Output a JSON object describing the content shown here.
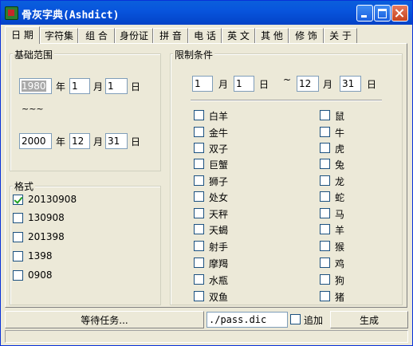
{
  "window": {
    "title": "骨灰字典(Ashdict)"
  },
  "tabs": [
    "日 期",
    "字符集",
    "组 合",
    "身份证",
    "拼 音",
    "电 话",
    "英 文",
    "其 他",
    "修 饰",
    "关 于"
  ],
  "date_range": {
    "title": "基础范围",
    "start": {
      "year": "1980",
      "month": "1",
      "day": "1"
    },
    "separator": "~~~",
    "end": {
      "year": "2000",
      "month": "12",
      "day": "31"
    },
    "units": {
      "year": "年",
      "month": "月",
      "day": "日"
    }
  },
  "format": {
    "title": "格式",
    "options": [
      {
        "label": "20130908",
        "checked": true
      },
      {
        "label": "130908",
        "checked": false
      },
      {
        "label": "201398",
        "checked": false
      },
      {
        "label": "1398",
        "checked": false
      },
      {
        "label": "0908",
        "checked": false
      }
    ]
  },
  "limits": {
    "title": "限制条件",
    "from": {
      "month": "1",
      "day": "1"
    },
    "tilde": "~",
    "to": {
      "month": "12",
      "day": "31"
    },
    "zodiac_signs": [
      "白羊",
      "金牛",
      "双子",
      "巨蟹",
      "狮子",
      "处女",
      "天秤",
      "天蝎",
      "射手",
      "摩羯",
      "水瓶",
      "双鱼"
    ],
    "chinese_zodiac": [
      "鼠",
      "牛",
      "虎",
      "兔",
      "龙",
      "蛇",
      "马",
      "羊",
      "猴",
      "鸡",
      "狗",
      "猪"
    ]
  },
  "status_bar": {
    "task_label": "等待任务...",
    "output_file": "./pass.dic",
    "append_label": "追加",
    "generate_label": "生成"
  }
}
